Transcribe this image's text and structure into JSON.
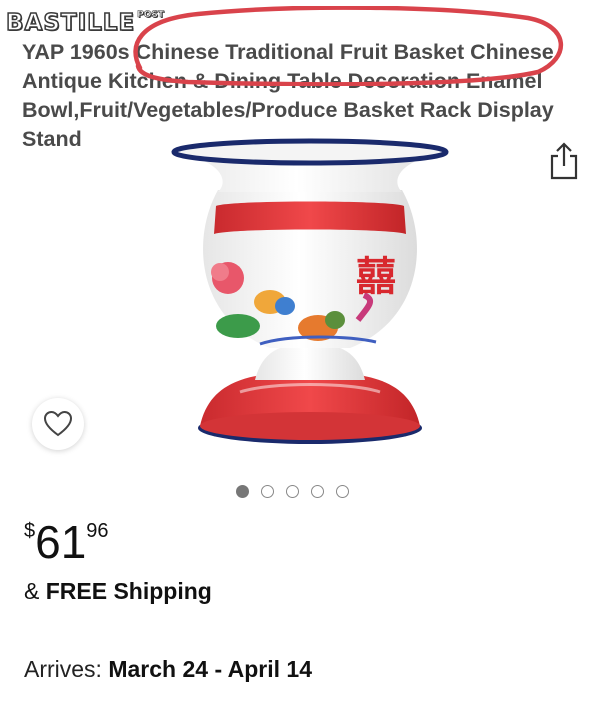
{
  "watermark": {
    "text": "BASTILLE",
    "sub": "POST"
  },
  "product": {
    "title_line1": "YAP 1960s Chinese Traditional Fruit Basket Chinese",
    "title_line2": "Antique Kitchen & Dining Table Decoration Enamel",
    "title_line3": "Bowl,Fruit/Vegetables/Produce Basket Rack Display Stand",
    "image_icon": "enamel-spittoon-image"
  },
  "actions": {
    "share_icon": "share-icon",
    "wishlist_icon": "heart-icon"
  },
  "carousel": {
    "count": 5,
    "active_index": 0
  },
  "price": {
    "currency": "$",
    "whole": "61",
    "fraction": "96"
  },
  "shipping": {
    "prefix": "& ",
    "text": "FREE Shipping"
  },
  "delivery": {
    "label": "Arrives: ",
    "dates": "March 24 - April 14"
  },
  "colors": {
    "annotation": "#d9434b",
    "enamel_red": "#e03a3e",
    "rim_blue": "#1a2a6c"
  }
}
